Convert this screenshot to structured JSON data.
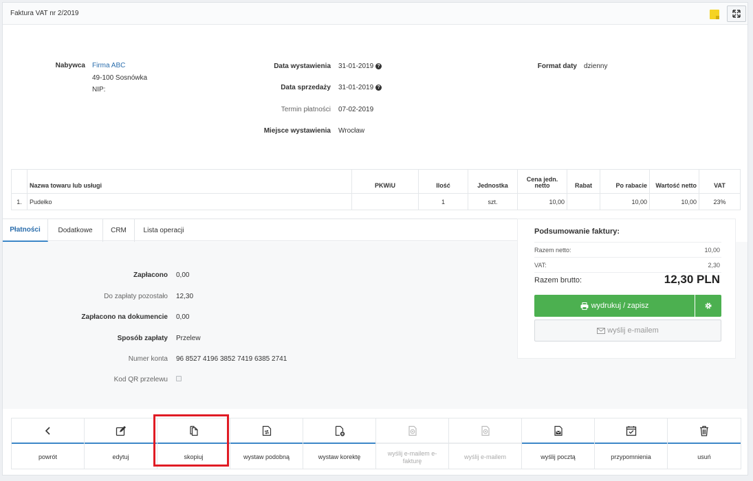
{
  "header": {
    "title": "Faktura VAT nr 2/2019",
    "sticky_icon": "sticky-note-icon",
    "expand_icon": "expand-icon"
  },
  "buyer": {
    "label": "Nabywca",
    "name": "Firma ABC",
    "address": "49-100 Sosnówka",
    "nip": "NIP:"
  },
  "dates": {
    "issue_label": "Data wystawienia",
    "issue_value": "31-01-2019",
    "sale_label": "Data sprzedaży",
    "sale_value": "31-01-2019",
    "due_label": "Termin płatności",
    "due_value": "07-02-2019",
    "place_label": "Miejsce wystawienia",
    "place_value": "Wrocław"
  },
  "format": {
    "label": "Format daty",
    "value": "dzienny"
  },
  "items_table": {
    "headers": [
      "",
      "Nazwa towaru lub usługi",
      "PKWiU",
      "Ilość",
      "Jednostka",
      "Cena jedn. netto",
      "Rabat",
      "Po rabacie",
      "Wartość netto",
      "VAT"
    ],
    "rows": [
      [
        "1.",
        "Pudełko",
        "",
        "1",
        "szt.",
        "10,00",
        "",
        "10,00",
        "10,00",
        "23%"
      ]
    ]
  },
  "tabs": [
    "Płatności",
    "Dodatkowe",
    "CRM",
    "Lista operacji"
  ],
  "payments": {
    "paid_label": "Zapłacono",
    "paid_value": "0,00",
    "remaining_label": "Do zapłaty pozostało",
    "remaining_value": "12,30",
    "paid_doc_label": "Zapłacono na dokumencie",
    "paid_doc_value": "0,00",
    "method_label": "Sposób zapłaty",
    "method_value": "Przelew",
    "account_label": "Numer konta",
    "account_value": "96 8527 4196 3852 7419 6385 2741",
    "qr_label": "Kod QR przelewu",
    "qr_checked": false
  },
  "summary": {
    "title": "Podsumowanie faktury:",
    "net_label": "Razem netto:",
    "net_value": "10,00",
    "vat_label": "VAT:",
    "vat_value": "2,30",
    "gross_label": "Razem brutto:",
    "gross_value": "12,30 PLN",
    "print_label": "wydrukuj / zapisz",
    "mail_label": "wyślij e-mailem",
    "accent_color": "#4cb050"
  },
  "actions": [
    {
      "label": "powrót",
      "icon": "chevron-left-icon",
      "enabled": true
    },
    {
      "label": "edytuj",
      "icon": "edit-icon",
      "enabled": true
    },
    {
      "label": "skopiuj",
      "icon": "copy-icon",
      "enabled": true
    },
    {
      "label": "wystaw podobną",
      "icon": "similar-document-icon",
      "enabled": true
    },
    {
      "label": "wystaw korektę",
      "icon": "add-document-icon",
      "enabled": true
    },
    {
      "label": "wyślij e-mailem e-fakturę",
      "icon": "email-document-icon",
      "enabled": false
    },
    {
      "label": "wyślij e-mailem",
      "icon": "email-icon",
      "enabled": false
    },
    {
      "label": "wyślij pocztą",
      "icon": "post-icon",
      "enabled": true
    },
    {
      "label": "przypomnienia",
      "icon": "calendar-check-icon",
      "enabled": true
    },
    {
      "label": "usuń",
      "icon": "trash-icon",
      "enabled": true
    }
  ],
  "highlight_color": "#e01b24"
}
